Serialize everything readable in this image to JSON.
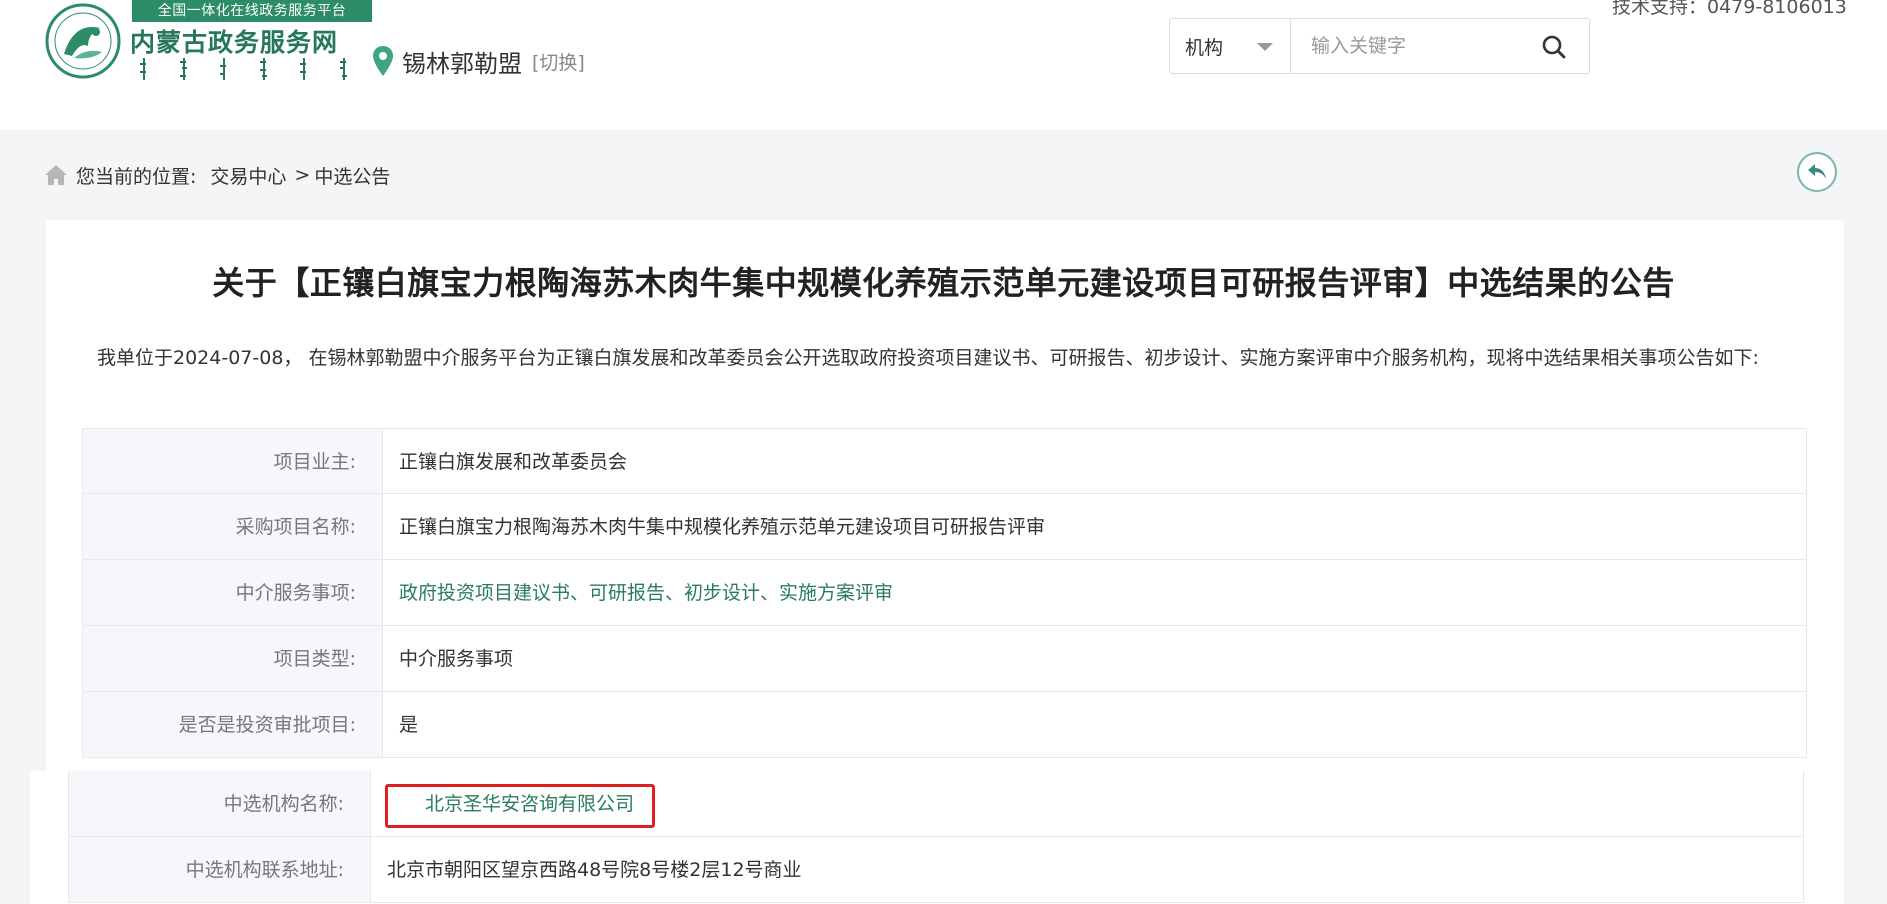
{
  "header": {
    "logo_banner": "全国一体化在线政务服务平台",
    "logo_name": "内蒙古政务服务网",
    "city": "锡林郭勒盟",
    "switch": "[切换]",
    "search_type": "机构",
    "search_placeholder": "输入关键字",
    "tech_support": "技术支持：0479-8106013"
  },
  "breadcrumb": {
    "label": "您当前的位置:",
    "crumb1": "交易中心",
    "sep": ">",
    "crumb2": "中选公告"
  },
  "notice": {
    "title": "关于【正镶白旗宝力根陶海苏木肉牛集中规模化养殖示范单元建设项目可研报告评审】中选结果的公告",
    "intro": "我单位于2024-07-08， 在锡林郭勒盟中介服务平台为正镶白旗发展和改革委员会公开选取政府投资项目建议书、可研报告、初步设计、实施方案评审中介服务机构，现将中选结果相关事项公告如下:"
  },
  "table": {
    "rows": [
      {
        "label": "项目业主:",
        "value": "正镶白旗发展和改革委员会"
      },
      {
        "label": "采购项目名称:",
        "value": "正镶白旗宝力根陶海苏木肉牛集中规模化养殖示范单元建设项目可研报告评审"
      },
      {
        "label": "中介服务事项:",
        "value": "政府投资项目建议书、可研报告、初步设计、实施方案评审"
      },
      {
        "label": "项目类型:",
        "value": "中介服务事项"
      },
      {
        "label": "是否是投资审批项目:",
        "value": "是"
      }
    ],
    "overlay_rows": [
      {
        "label": "中选机构名称:",
        "value": "北京圣华安咨询有限公司"
      },
      {
        "label": "中选机构联系地址:",
        "value": "北京市朝阳区望京西路48号院8号楼2层12号商业"
      }
    ]
  },
  "colors": {
    "brand_green": "#2c8c66",
    "link_green": "#2a7d5c",
    "highlight_red": "#e02020"
  },
  "icons": [
    "location-pin-icon",
    "caret-down-icon",
    "search-icon",
    "home-icon",
    "back-arrow-icon"
  ]
}
